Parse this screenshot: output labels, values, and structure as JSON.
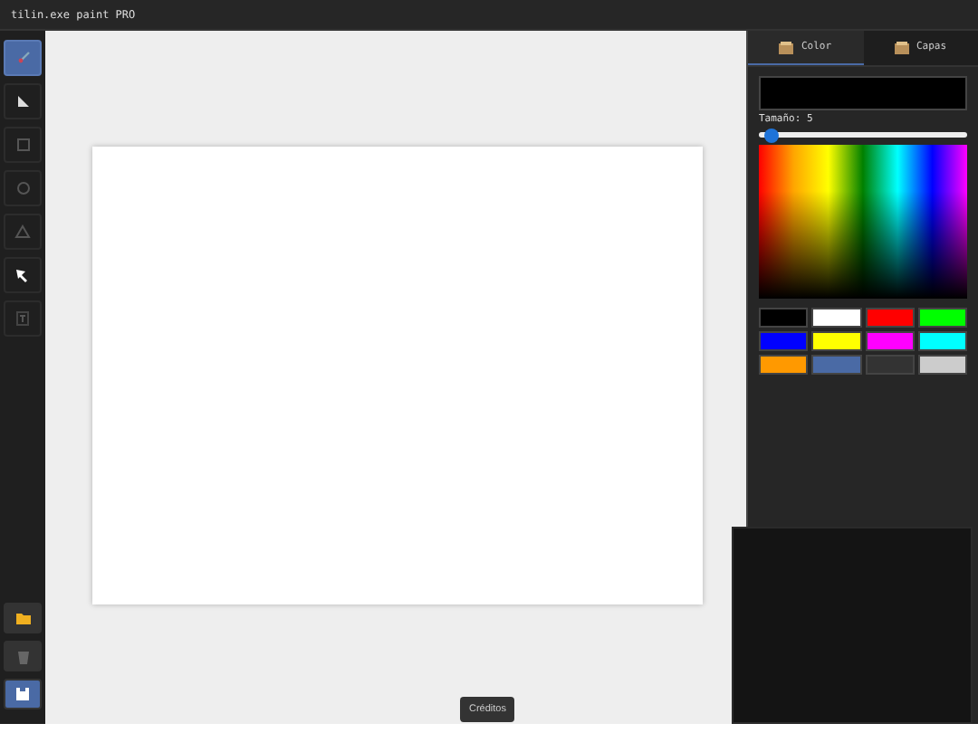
{
  "window": {
    "title": "tilin.exe paint PRO"
  },
  "tools": [
    {
      "kind": "brush",
      "selected": true
    },
    {
      "kind": "fill",
      "selected": false
    },
    {
      "kind": "rect",
      "selected": false
    },
    {
      "kind": "circle",
      "selected": false
    },
    {
      "kind": "triangle",
      "selected": false
    },
    {
      "kind": "pointer",
      "selected": false
    },
    {
      "kind": "text",
      "selected": false
    }
  ],
  "actions": [
    {
      "kind": "open",
      "highlighted": false
    },
    {
      "kind": "delete",
      "highlighted": false
    },
    {
      "kind": "save",
      "highlighted": true
    }
  ],
  "tabs": [
    {
      "label": "Color",
      "selected": true
    },
    {
      "label": "Capas",
      "selected": false
    }
  ],
  "current_color": {
    "color": "#000000"
  },
  "size": {
    "label": "Tamaño: 5",
    "level": 0.06
  },
  "swatches": [
    {
      "color": "#000000"
    },
    {
      "color": "#ffffff"
    },
    {
      "color": "#ff0000"
    },
    {
      "color": "#00ff00"
    },
    {
      "color": "#0000ff"
    },
    {
      "color": "#ffff00"
    },
    {
      "color": "#ff00ff"
    },
    {
      "color": "#00ffff"
    },
    {
      "color": "#ff9900"
    },
    {
      "color": "#4a6aa5"
    },
    {
      "color": "#333333"
    },
    {
      "color": "#cccccc"
    }
  ],
  "credits_button": "Créditos"
}
